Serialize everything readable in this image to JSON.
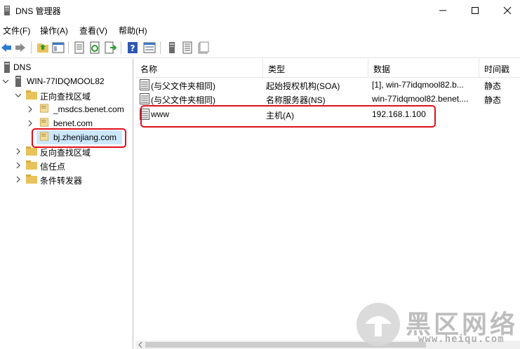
{
  "window": {
    "title": "DNS 管理器"
  },
  "menu": [
    "文件(F)",
    "操作(A)",
    "查看(V)",
    "帮助(H)"
  ],
  "toolbar_icons": [
    "back-arrow-icon",
    "forward-arrow-icon",
    "up-folder-icon",
    "show-tree-icon",
    "properties-icon",
    "refresh-icon",
    "export-list-icon",
    "help-icon",
    "show-hide-icon",
    "server-icon",
    "record-list-icon",
    "zone-icon"
  ],
  "tree": {
    "root": "DNS",
    "server": "WIN-77IDQMOOL82",
    "forward_zones": "正向查找区域",
    "zones": [
      "_msdcs.benet.com",
      "benet.com",
      "bj.zhenjiang.com"
    ],
    "reverse_zones": "反向查找区域",
    "trust_points": "信任点",
    "conditional_forwarders": "条件转发器"
  },
  "columns": [
    "名称",
    "类型",
    "数据",
    "时间戳"
  ],
  "records": [
    {
      "name": "(与父文件夹相同)",
      "type": "起始授权机构(SOA)",
      "data": "[1], win-77idqmool82.b...",
      "timestamp": "静态"
    },
    {
      "name": "(与父文件夹相同)",
      "type": "名称服务器(NS)",
      "data": "win-77idqmool82.benet....",
      "timestamp": "静态"
    },
    {
      "name": "www",
      "type": "主机(A)",
      "data": "192.168.1.100",
      "timestamp": ""
    }
  ],
  "watermark": {
    "text": "黑区网络",
    "url": "www.heiqu.com"
  },
  "colors": {
    "highlight": "#e0101a",
    "selection": "#cce8ff"
  }
}
